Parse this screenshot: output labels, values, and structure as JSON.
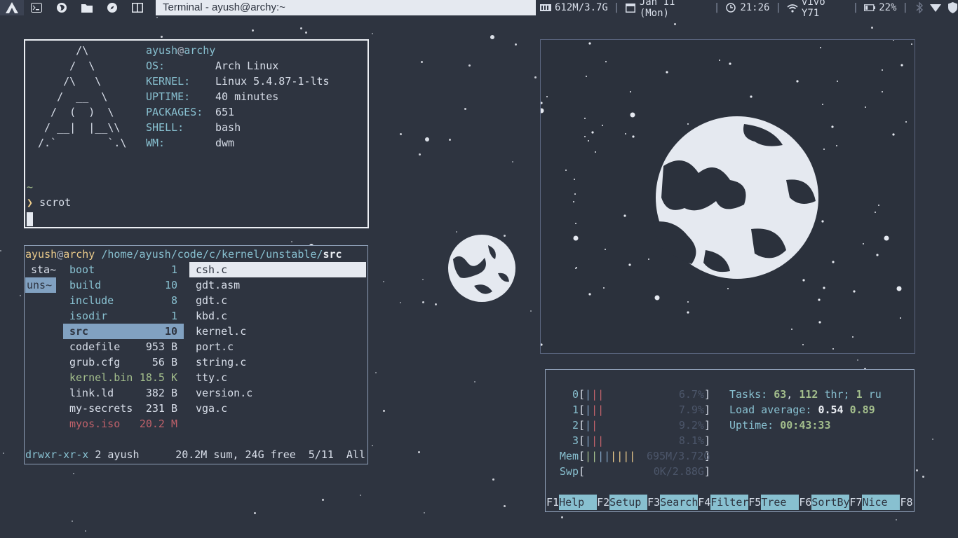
{
  "bar": {
    "title": "Terminal - ayush@archy:~",
    "status": {
      "memory": "612M/3.7G",
      "date": "Jan 11 (Mon)",
      "time": "21:26",
      "wifi": "vivo Y71",
      "battery": "22%"
    },
    "icons": [
      "arch-logo-icon",
      "terminal-icon",
      "firefox-icon",
      "folder-icon",
      "compass-icon",
      "split-window-icon"
    ]
  },
  "neofetch": {
    "ascii": "      /\\\n     /  \\\n    /\\   \\\n   /  __  \\\n  /  (  )  \\\n / __|  |__\\\\\n/.`        `.\\",
    "user": "ayush",
    "at": "@",
    "host": "archy",
    "rows": [
      {
        "key": "OS:",
        "value": "Arch Linux"
      },
      {
        "key": "KERNEL:",
        "value": "Linux 5.4.87-1-lts"
      },
      {
        "key": "UPTIME:",
        "value": "40 minutes"
      },
      {
        "key": "PACKAGES:",
        "value": "651"
      },
      {
        "key": "SHELL:",
        "value": "bash"
      },
      {
        "key": "WM:",
        "value": "dwm"
      }
    ],
    "tilde": "~",
    "prompt_symbol": "❯",
    "command": "scrot"
  },
  "files": {
    "user": "ayush",
    "at": "@",
    "host": "archy",
    "path": "/home/ayush/code/c/kernel/unstable/",
    "current": "src",
    "parent": [
      {
        "name": "sta~",
        "selected": false
      },
      {
        "name": "uns~",
        "selected": true
      }
    ],
    "entries": [
      {
        "name": "boot",
        "size": "1",
        "kind": "dir"
      },
      {
        "name": "build",
        "size": "10",
        "kind": "dir"
      },
      {
        "name": "include",
        "size": "8",
        "kind": "dir"
      },
      {
        "name": "isodir",
        "size": "1",
        "kind": "dir"
      },
      {
        "name": "src",
        "size": "10",
        "kind": "dir-selected"
      },
      {
        "name": "codefile",
        "size": "953 B",
        "kind": "file"
      },
      {
        "name": "grub.cfg",
        "size": "56 B",
        "kind": "file"
      },
      {
        "name": "kernel.bin",
        "size": "18.5 K",
        "kind": "exec"
      },
      {
        "name": "link.ld",
        "size": "382 B",
        "kind": "file"
      },
      {
        "name": "my-secrets",
        "size": "231 B",
        "kind": "file"
      },
      {
        "name": "myos.iso",
        "size": "20.2 M",
        "kind": "archive"
      }
    ],
    "preview": [
      "csh.c",
      "gdt.asm",
      "gdt.c",
      "kbd.c",
      "kernel.c",
      "port.c",
      "string.c",
      "tty.c",
      "version.c",
      "vga.c"
    ],
    "status": {
      "perm": "drwxr-xr-x",
      "links": "2",
      "owner": "ayush",
      "summary": "20.2M sum, 24G free",
      "position": "5/11",
      "scroll": "All"
    }
  },
  "htop": {
    "cpus": [
      {
        "label": "0",
        "bars": "|||",
        "value": "6.7%"
      },
      {
        "label": "1",
        "bars": "|||",
        "value": "7.9%"
      },
      {
        "label": "2",
        "bars": "||",
        "value": "9.2%"
      },
      {
        "label": "3",
        "bars": "|||",
        "value": "8.1%"
      }
    ],
    "mem": {
      "label": "Mem",
      "bars": "||||||||",
      "value": "695M/3.72G"
    },
    "swp": {
      "label": "Swp",
      "value": "0K/2.88G"
    },
    "tasks_label": "Tasks:",
    "tasks": "63",
    "threads": "112",
    "thr_label": "thr;",
    "running": "1",
    "run_label": "ru",
    "load_label": "Load average:",
    "load1": "0.54",
    "load5": "0.89",
    "uptime_label": "Uptime:",
    "uptime": "00:43:33",
    "fkeys": [
      {
        "key": "F1",
        "label": "Help"
      },
      {
        "key": "F2",
        "label": "Setup"
      },
      {
        "key": "F3",
        "label": "Search"
      },
      {
        "key": "F4",
        "label": "Filter"
      },
      {
        "key": "F5",
        "label": "Tree"
      },
      {
        "key": "F6",
        "label": "SortBy"
      },
      {
        "key": "F7",
        "label": "Nice -"
      },
      {
        "key": "F8",
        "label": ""
      }
    ]
  }
}
